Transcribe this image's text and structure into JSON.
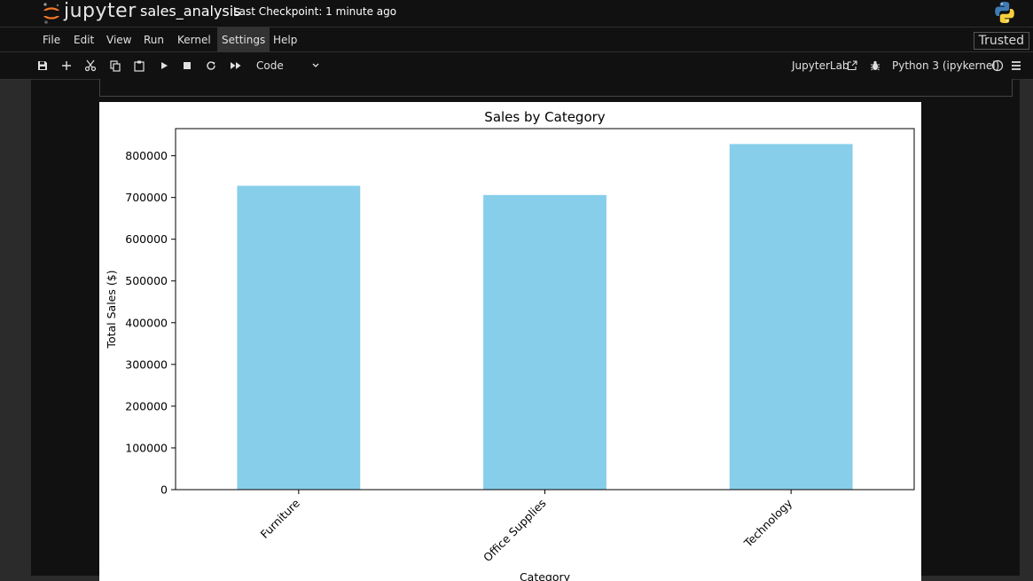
{
  "app": {
    "logo_text": "jupyter",
    "notebook_title": "sales_analysis",
    "checkpoint": "Last Checkpoint: 1 minute ago"
  },
  "menu": {
    "items": [
      "File",
      "Edit",
      "View",
      "Run",
      "Kernel",
      "Settings",
      "Help"
    ],
    "trusted": "Trusted"
  },
  "toolbar": {
    "cell_type": "Code",
    "jupyterlab_label": "JupyterLab",
    "kernel_label": "Python 3 (ipykernel)"
  },
  "chart_data": {
    "type": "bar",
    "title": "Sales by Category",
    "xlabel": "Category",
    "ylabel": "Total Sales ($)",
    "categories": [
      "Furniture",
      "Office Supplies",
      "Technology"
    ],
    "values": [
      728000,
      706000,
      828000
    ],
    "ylim": [
      0,
      865000
    ],
    "yticks": [
      0,
      100000,
      200000,
      300000,
      400000,
      500000,
      600000,
      700000,
      800000
    ],
    "bar_color": "#87ceeb",
    "grid": false,
    "x_tick_rotation": 45
  }
}
